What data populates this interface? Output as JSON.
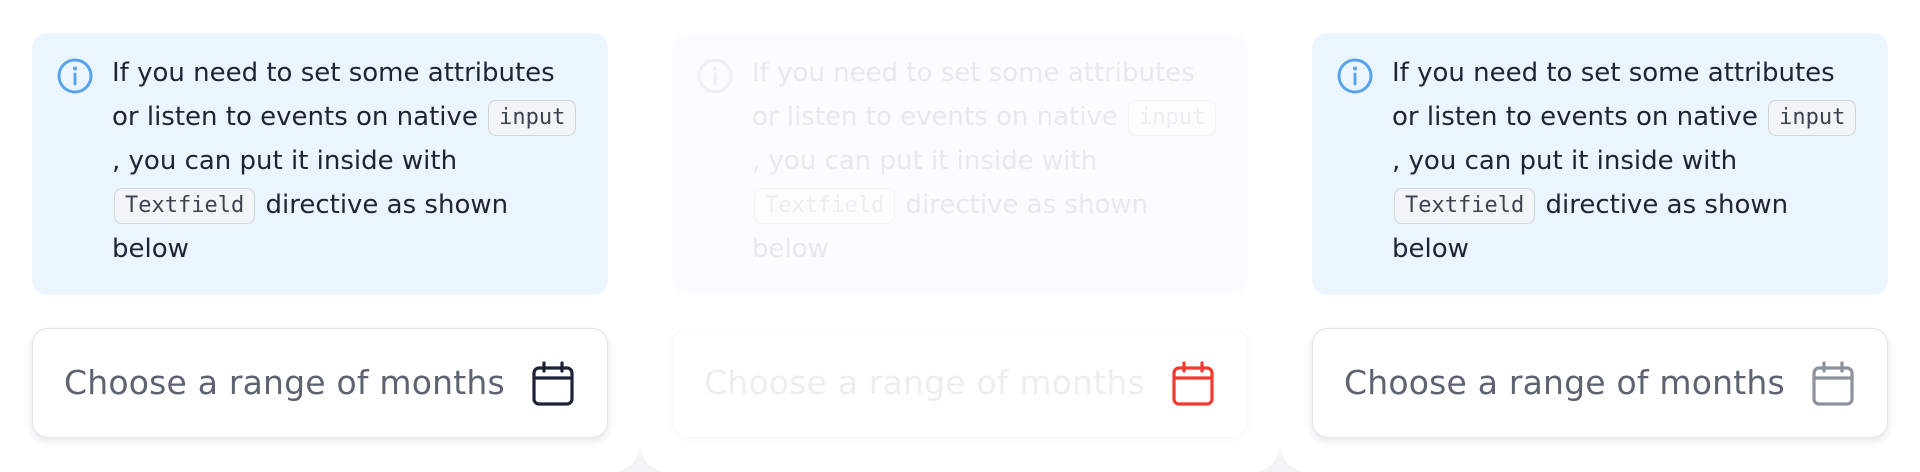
{
  "variants": [
    {
      "state": "default",
      "alert": {
        "icon": "info-circle-icon",
        "icon_color": "#5aa4ec",
        "text_before_input": "If you need to set some attributes or listen to events on native",
        "code_input": "input",
        "text_after_input": ", you can put it inside with",
        "code_textfield": "Textfield",
        "text_end": "directive as shown below"
      },
      "field": {
        "placeholder": "Choose a range of months",
        "icon": "calendar-icon",
        "icon_color": "#1c2336"
      }
    },
    {
      "state": "disabled",
      "alert": {
        "icon": "info-circle-icon",
        "icon_color": "#eef0f3",
        "text_before_input": "If you need to set some attributes or listen to events on native",
        "code_input": "input",
        "text_after_input": ", you can put it inside with",
        "code_textfield": "Textfield",
        "text_end": "directive as shown below"
      },
      "field": {
        "placeholder": "Choose a range of months",
        "icon": "calendar-icon",
        "icon_color": "#f03a2e"
      }
    },
    {
      "state": "default",
      "alert": {
        "icon": "info-circle-icon",
        "icon_color": "#5aa4ec",
        "text_before_input": "If you need to set some attributes or listen to events on native",
        "code_input": "input",
        "text_after_input": ", you can put it inside with",
        "code_textfield": "Textfield",
        "text_end": "directive as shown below"
      },
      "field": {
        "placeholder": "Choose a range of months",
        "icon": "calendar-icon",
        "icon_color": "#8c919b"
      }
    }
  ]
}
